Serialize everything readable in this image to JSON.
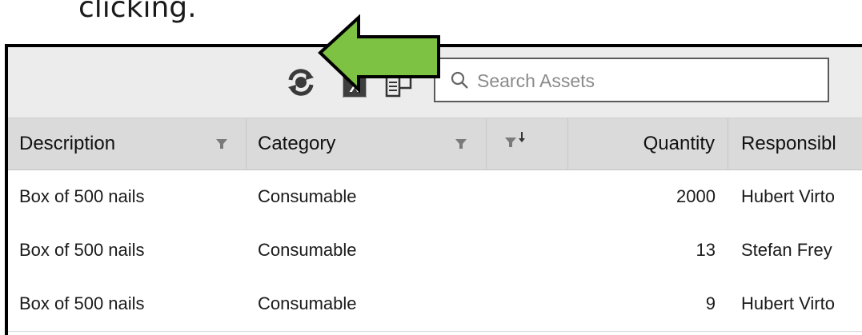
{
  "caption": "clicking.",
  "toolbar": {
    "icons": [
      "refresh-icon",
      "excel-export-icon",
      "column-chooser-icon"
    ],
    "search_placeholder": "Search Assets"
  },
  "columns": [
    {
      "label": "Description",
      "filter": true
    },
    {
      "label": "Category",
      "filter": true
    },
    {
      "label": "",
      "filter": true,
      "sorted": "descending"
    },
    {
      "label": "Quantity",
      "filter": false
    },
    {
      "label": "Responsibl",
      "filter": false
    }
  ],
  "rows": [
    {
      "description": "Box of 500 nails",
      "category": "Consumable",
      "quantity": "2000",
      "responsible": "Hubert Virto"
    },
    {
      "description": "Box of 500 nails",
      "category": "Consumable",
      "quantity": "13",
      "responsible": "Stefan Frey"
    },
    {
      "description": "Box of 500 nails",
      "category": "Consumable",
      "quantity": "9",
      "responsible": "Hubert Virto"
    }
  ],
  "colors": {
    "arrow_fill": "#7dc242",
    "toolbar_bg": "#ececec",
    "header_bg": "#dadada"
  }
}
